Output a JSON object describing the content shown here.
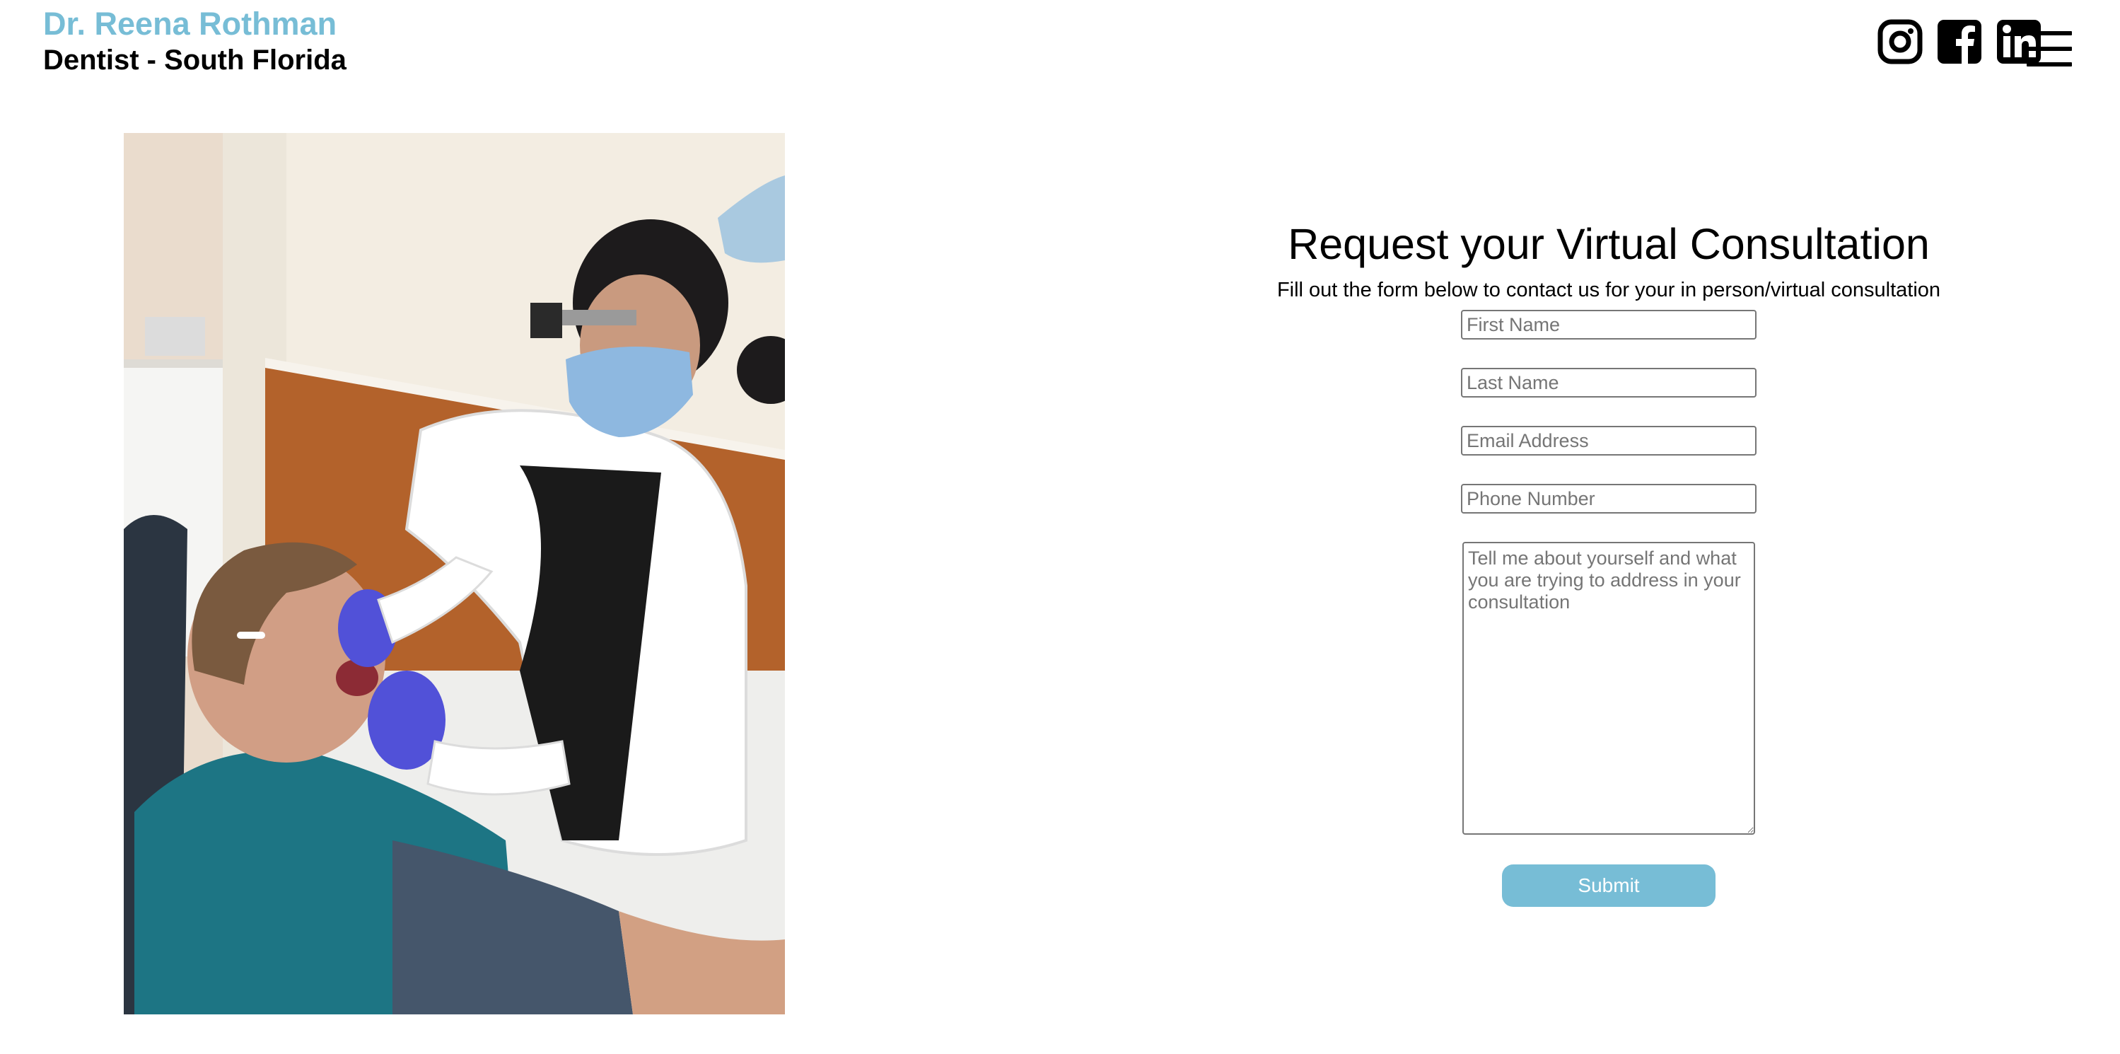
{
  "header": {
    "name": "Dr. Reena Rothman",
    "subtitle": "Dentist - South Florida"
  },
  "social": {
    "icons": [
      "instagram-icon",
      "facebook-icon",
      "linkedin-icon"
    ],
    "menu_icon": "hamburger-menu-icon"
  },
  "form": {
    "title": "Request your Virtual Consultation",
    "subtitle": "Fill out the form below to contact us for your in person/virtual consultation",
    "first_name_placeholder": "First Name",
    "last_name_placeholder": "Last Name",
    "email_placeholder": "Email Address",
    "phone_placeholder": "Phone Number",
    "message_placeholder": "Tell me about yourself and what you are trying to address in your consultation",
    "submit_label": "Submit"
  },
  "colors": {
    "accent": "#77bdd6",
    "text": "#000000",
    "background": "#ffffff"
  }
}
